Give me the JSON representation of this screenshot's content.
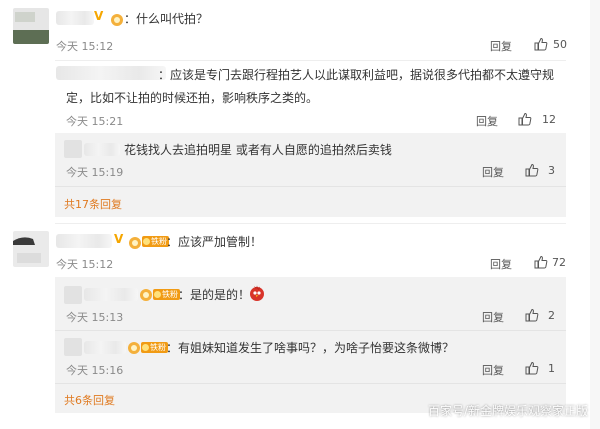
{
  "comments": [
    {
      "text": "：什么叫代拍？",
      "time": "今天 15:12",
      "reply_label": "回复",
      "likes": "50",
      "replies": [],
      "more_label": ""
    },
    {
      "text_line1": "：应该是专门去跟行程拍艺人以此谋取利益吧，据说很多代拍都不太遵守规",
      "text_line2": "定，比如不让拍的时候还拍，影响秩序之类的。",
      "time": "今天 15:21",
      "reply_label": "回复",
      "likes": "12",
      "replies": [
        {
          "text": "花钱找人去追拍明星 或者有人自愿的追拍然后卖钱",
          "time": "今天 15:19",
          "reply_label": "回复",
          "likes": "3"
        }
      ],
      "more_label": "共17条回复"
    },
    {
      "text": "：应该严加管制！",
      "badge": "铁粉",
      "time": "今天 15:12",
      "reply_label": "回复",
      "likes": "72",
      "replies": [
        {
          "badge": "铁粉",
          "text": "：是的是的！",
          "time": "今天 15:13",
          "reply_label": "回复",
          "likes": "2"
        },
        {
          "badge": "铁粉",
          "text": "：有姐妹知道发生了啥事吗？，为啥子怡要这条微博？",
          "time": "今天 15:16",
          "reply_label": "回复",
          "likes": "1"
        }
      ],
      "more_label": "共6条回复"
    }
  ],
  "watermark": "百家号/新金牌娱乐观察家正版",
  "colors": {
    "more_link": "#e07a20",
    "badge": "#f19b14",
    "vip": "#f5a600",
    "sub_background": "#f2f2f2"
  },
  "icons": [
    "thumbs-up-icon",
    "vip-icon",
    "fan-badge-icon",
    "medal-icon",
    "angry-bird-emoji"
  ]
}
